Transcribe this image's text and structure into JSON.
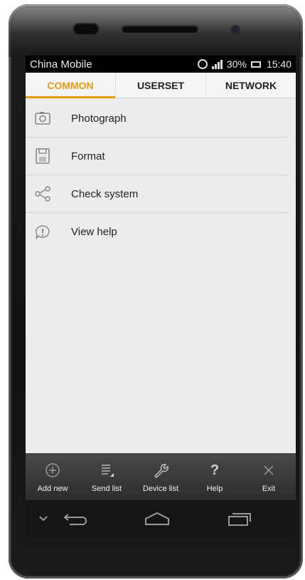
{
  "status_bar": {
    "carrier": "China Mobile",
    "battery": "30%",
    "time": "15:40"
  },
  "tabs": [
    {
      "label": "COMMON",
      "active": true
    },
    {
      "label": "USERSET",
      "active": false
    },
    {
      "label": "NETWORK",
      "active": false
    }
  ],
  "menu": [
    {
      "label": "Photograph",
      "icon": "camera-icon"
    },
    {
      "label": "Format",
      "icon": "floppy-disk-icon"
    },
    {
      "label": "Check system",
      "icon": "share-nodes-icon"
    },
    {
      "label": "View help",
      "icon": "info-bubble-icon"
    }
  ],
  "actions": [
    {
      "label": "Add new",
      "icon": "plus-circle-icon"
    },
    {
      "label": "Send list",
      "icon": "list-icon"
    },
    {
      "label": "Device list",
      "icon": "wrench-icon"
    },
    {
      "label": "Help",
      "icon": "question-icon"
    },
    {
      "label": "Exit",
      "icon": "close-icon"
    }
  ],
  "colors": {
    "accent": "#e79a16",
    "screen_bg": "#ececec",
    "action_bar": "#2c2c2c"
  }
}
